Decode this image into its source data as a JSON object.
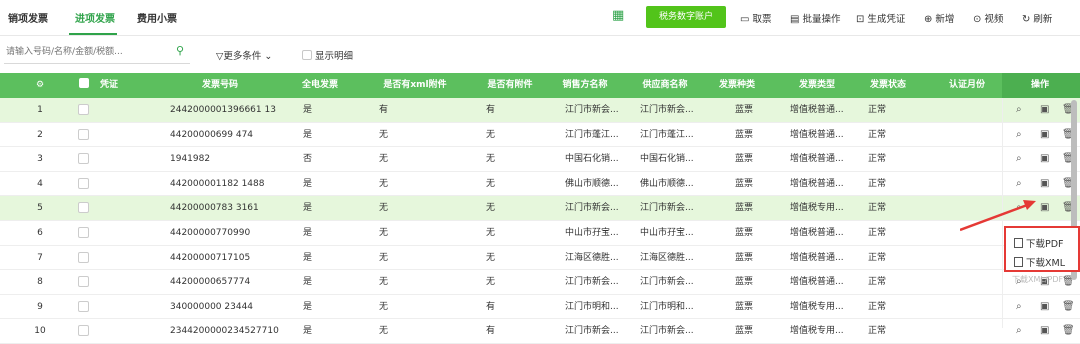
{
  "tabs": [
    "销项发票",
    "进项发票",
    "费用小票"
  ],
  "active_tab": 1,
  "toolbar": {
    "tax_account_button": "税务数字账户",
    "items": [
      {
        "icon": "receipt-icon",
        "label": "取票"
      },
      {
        "icon": "batch-icon",
        "label": "批量操作"
      },
      {
        "icon": "voucher-icon",
        "label": "生成凭证"
      },
      {
        "icon": "plus-circle-icon",
        "label": "新增"
      },
      {
        "icon": "video-icon",
        "label": "视频"
      },
      {
        "icon": "refresh-icon",
        "label": "刷新"
      }
    ]
  },
  "search": {
    "placeholder": "请输入号码/名称/金额/税额..."
  },
  "more_conditions": "更多条件",
  "show_detail_label": "显示明细",
  "columns": [
    "凭证",
    "发票号码",
    "全电发票",
    "是否有xml附件",
    "是否有附件",
    "销售方名称",
    "供应商名称",
    "发票种类",
    "发票类型",
    "发票状态",
    "认证月份",
    "操作"
  ],
  "rows": [
    {
      "num": "1",
      "invoice": "2442000001396661 13",
      "full": "是",
      "xml": "有",
      "att": "有",
      "seller": "江门市新会...",
      "supplier": "江门市新会...",
      "kind": "蓝票",
      "type": "增值税普通...",
      "status": "正常",
      "hl": true
    },
    {
      "num": "2",
      "invoice": "44200000699 474",
      "full": "是",
      "xml": "无",
      "att": "无",
      "seller": "江门市蓬江...",
      "supplier": "江门市蓬江...",
      "kind": "蓝票",
      "type": "增值税普通...",
      "status": "正常",
      "hl": false
    },
    {
      "num": "3",
      "invoice": "1941982",
      "full": "否",
      "xml": "无",
      "att": "无",
      "seller": "中国石化销...",
      "supplier": "中国石化销...",
      "kind": "蓝票",
      "type": "增值税普通...",
      "status": "正常",
      "hl": false
    },
    {
      "num": "4",
      "invoice": "442000001182 1488",
      "full": "是",
      "xml": "无",
      "att": "无",
      "seller": "佛山市顺德...",
      "supplier": "佛山市顺德...",
      "kind": "蓝票",
      "type": "增值税普通...",
      "status": "正常",
      "hl": false
    },
    {
      "num": "5",
      "invoice": "44200000783 3161",
      "full": "是",
      "xml": "无",
      "att": "无",
      "seller": "江门市新会...",
      "supplier": "江门市新会...",
      "kind": "蓝票",
      "type": "增值税专用...",
      "status": "正常",
      "hl": true
    },
    {
      "num": "6",
      "invoice": "44200000770990",
      "full": "是",
      "xml": "无",
      "att": "无",
      "seller": "中山市孖宝...",
      "supplier": "中山市孖宝...",
      "kind": "蓝票",
      "type": "增值税普通...",
      "status": "正常",
      "hl": false
    },
    {
      "num": "7",
      "invoice": "44200000717105",
      "full": "是",
      "xml": "无",
      "att": "无",
      "seller": "江海区德胜...",
      "supplier": "江海区德胜...",
      "kind": "蓝票",
      "type": "增值税普通...",
      "status": "正常",
      "hl": false
    },
    {
      "num": "8",
      "invoice": "44200000657774",
      "full": "是",
      "xml": "无",
      "att": "无",
      "seller": "江门市新会...",
      "supplier": "江门市新会...",
      "kind": "蓝票",
      "type": "增值税普通...",
      "status": "正常",
      "hl": false
    },
    {
      "num": "9",
      "invoice": "340000000 23444",
      "full": "是",
      "xml": "无",
      "att": "有",
      "seller": "江门市明和...",
      "supplier": "江门市明和...",
      "kind": "蓝票",
      "type": "增值税专用...",
      "status": "正常",
      "hl": false
    },
    {
      "num": "10",
      "invoice": "2344200000234527710",
      "full": "是",
      "xml": "无",
      "att": "有",
      "seller": "江门市新会...",
      "supplier": "江门市新会...",
      "kind": "蓝票",
      "type": "增值税专用...",
      "status": "正常",
      "hl": false
    }
  ],
  "popup": {
    "items": [
      "下载PDF",
      "下载XML"
    ],
    "ghost": "下载XML/PDF"
  },
  "colors": {
    "accent": "#2fa34a",
    "header": "#5cbf5e",
    "highlight": "#e6f7dc",
    "popup_border": "#e53935"
  }
}
